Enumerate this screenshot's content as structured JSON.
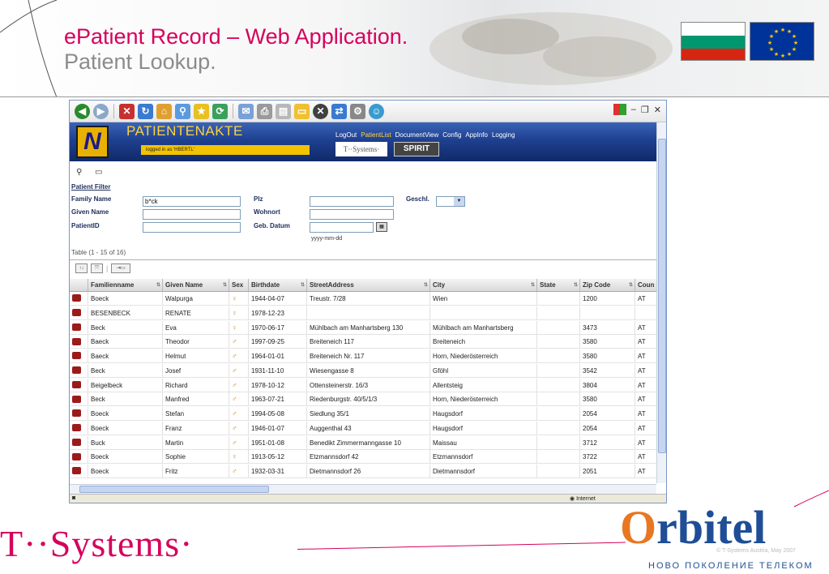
{
  "slide": {
    "title": "ePatient Record – Web Application.",
    "subtitle": "Patient Lookup."
  },
  "app": {
    "title": "PATIENTENAKTE",
    "logged_in": "logged in as 'HBERTL'",
    "nav": [
      "LogOut",
      "PatientList",
      "DocumentView",
      "Config",
      "AppInfo",
      "Logging"
    ],
    "nav_active": "PatientList",
    "tsystems_badge": "T··Systems·",
    "spirit_badge": "SPIRIT"
  },
  "filter": {
    "label": "Patient Filter",
    "family_name_label": "Family Name",
    "family_name_value": "b*ck",
    "given_name_label": "Given Name",
    "patient_id_label": "PatientID",
    "plz_label": "Plz",
    "wohnort_label": "Wohnort",
    "geb_datum_label": "Geb. Datum",
    "geschl_label": "Geschl.",
    "date_hint": "yyyy-mm-dd"
  },
  "table": {
    "count": "Table (1 - 15 of 16)",
    "columns": [
      "Familienname",
      "Given Name",
      "Sex",
      "Birthdate",
      "StreetAddress",
      "City",
      "State",
      "Zip Code",
      "Coun"
    ],
    "rows": [
      {
        "family": "Boeck",
        "given": "Walpurga",
        "sex": "f",
        "birth": "1944-04-07",
        "street": "Treustr. 7/28",
        "city": "Wien",
        "state": "",
        "zip": "1200",
        "country": "AT"
      },
      {
        "family": "BESENBECK",
        "given": "RENATE",
        "sex": "f",
        "birth": "1978-12-23",
        "street": "",
        "city": "",
        "state": "",
        "zip": "",
        "country": ""
      },
      {
        "family": "Beck",
        "given": "Eva",
        "sex": "f",
        "birth": "1970-06-17",
        "street": "Mühlbach am Manhartsberg 130",
        "city": "Mühlbach am Manhartsberg",
        "state": "",
        "zip": "3473",
        "country": "AT"
      },
      {
        "family": "Baeck",
        "given": "Theodor",
        "sex": "m",
        "birth": "1997-09-25",
        "street": "Breiteneich 117",
        "city": "Breiteneich",
        "state": "",
        "zip": "3580",
        "country": "AT"
      },
      {
        "family": "Baeck",
        "given": "Helmut",
        "sex": "m",
        "birth": "1964-01-01",
        "street": "Breiteneich Nr. 117",
        "city": "Horn, Niederösterreich",
        "state": "",
        "zip": "3580",
        "country": "AT"
      },
      {
        "family": "Beck",
        "given": "Josef",
        "sex": "m",
        "birth": "1931-11-10",
        "street": "Wiesengasse 8",
        "city": "Gföhl",
        "state": "",
        "zip": "3542",
        "country": "AT"
      },
      {
        "family": "Beigelbeck",
        "given": "Richard",
        "sex": "m",
        "birth": "1978-10-12",
        "street": "Ottensteinerstr. 16/3",
        "city": "Allentsteig",
        "state": "",
        "zip": "3804",
        "country": "AT"
      },
      {
        "family": "Beck",
        "given": "Manfred",
        "sex": "m",
        "birth": "1963-07-21",
        "street": "Riedenburgstr. 40/5/1/3",
        "city": "Horn, Niederösterreich",
        "state": "",
        "zip": "3580",
        "country": "AT"
      },
      {
        "family": "Boeck",
        "given": "Stefan",
        "sex": "m",
        "birth": "1994-05-08",
        "street": "Siedlung 35/1",
        "city": "Haugsdorf",
        "state": "",
        "zip": "2054",
        "country": "AT"
      },
      {
        "family": "Boeck",
        "given": "Franz",
        "sex": "m",
        "birth": "1946-01-07",
        "street": "Auggenthal 43",
        "city": "Haugsdorf",
        "state": "",
        "zip": "2054",
        "country": "AT"
      },
      {
        "family": "Buck",
        "given": "Martin",
        "sex": "m",
        "birth": "1951-01-08",
        "street": "Benedikt Zimmermanngasse 10",
        "city": "Maissau",
        "state": "",
        "zip": "3712",
        "country": "AT"
      },
      {
        "family": "Boeck",
        "given": "Sophie",
        "sex": "f",
        "birth": "1913-05-12",
        "street": "Etzmannsdorf 42",
        "city": "Etzmannsdorf",
        "state": "",
        "zip": "3722",
        "country": "AT"
      },
      {
        "family": "Boeck",
        "given": "Fritz",
        "sex": "m",
        "birth": "1932-03-31",
        "street": "Dietmannsdorf 26",
        "city": "Dietmannsdorf",
        "state": "",
        "zip": "2051",
        "country": "AT"
      }
    ]
  },
  "status": {
    "zone": "Internet"
  },
  "footer": {
    "tsystems": "T··Systems·",
    "orbitel_tagline": "НОВО ПОКОЛЕНИЕ ТЕЛЕКОМ",
    "copyright": "© T-Systems Austria, May 2007"
  },
  "icons": [
    "back-icon",
    "forward-icon",
    "stop-icon",
    "refresh-icon",
    "home-icon",
    "search-icon",
    "favorites-icon",
    "history-icon",
    "mail-icon",
    "print-icon",
    "patient-record-icon",
    "male-icon",
    "female-icon"
  ],
  "colors": {
    "brand_magenta": "#d6005c",
    "app_blue": "#1f4090",
    "app_yellow": "#ffd23c",
    "orbitel_blue": "#1f4e96",
    "orbitel_orange": "#e87722"
  }
}
